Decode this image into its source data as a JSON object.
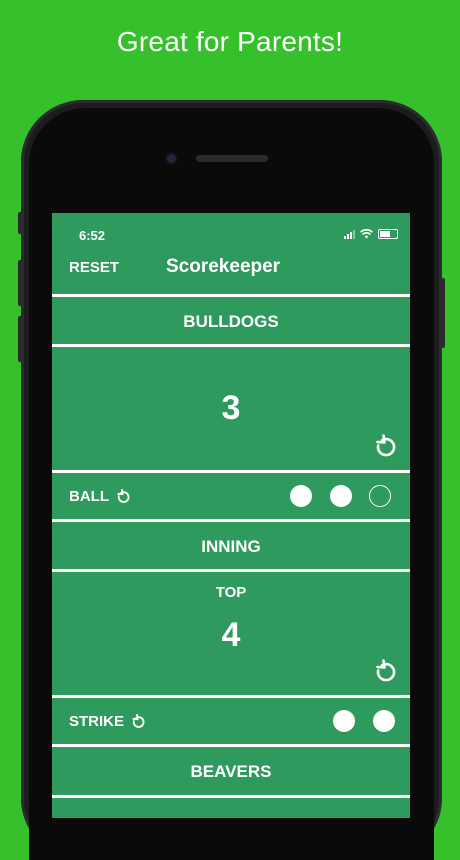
{
  "headline": "Great for Parents!",
  "status_bar": {
    "time": "6:52"
  },
  "nav": {
    "reset_label": "RESET",
    "title": "Scorekeeper"
  },
  "team_home": {
    "name": "BULLDOGS",
    "score": "3"
  },
  "ball": {
    "label": "BALL",
    "count": 2,
    "max": 3
  },
  "inning": {
    "label": "INNING",
    "half": "TOP",
    "number": "4"
  },
  "strike": {
    "label": "STRIKE",
    "count": 2,
    "max": 2
  },
  "team_away": {
    "name": "BEAVERS"
  },
  "colors": {
    "background": "#36c02b",
    "screen": "#2f9a5e",
    "text": "#ffffff"
  },
  "icons": [
    "undo-icon",
    "signal-icon",
    "wifi-icon",
    "battery-icon"
  ]
}
